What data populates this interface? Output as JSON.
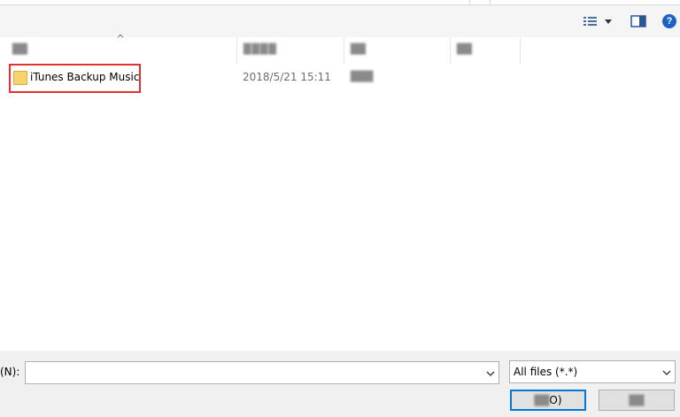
{
  "toolbar": {
    "view_icon": "view-details-icon",
    "preview_icon": "preview-pane-icon",
    "help_label": "?"
  },
  "columns": {
    "sort_indicator": "^"
  },
  "files": [
    {
      "name": "iTunes Backup Music",
      "date": "2018/5/21 15:11",
      "icon": "folder-icon"
    }
  ],
  "footer": {
    "filename_label": "(N):",
    "filename_value": "",
    "filetype_selected": "All files (*.*)",
    "open_button_suffix": "O)"
  },
  "colors": {
    "selection_border": "#e03030",
    "primary_button_border": "#0078d7",
    "help_blue": "#1c62c4"
  }
}
